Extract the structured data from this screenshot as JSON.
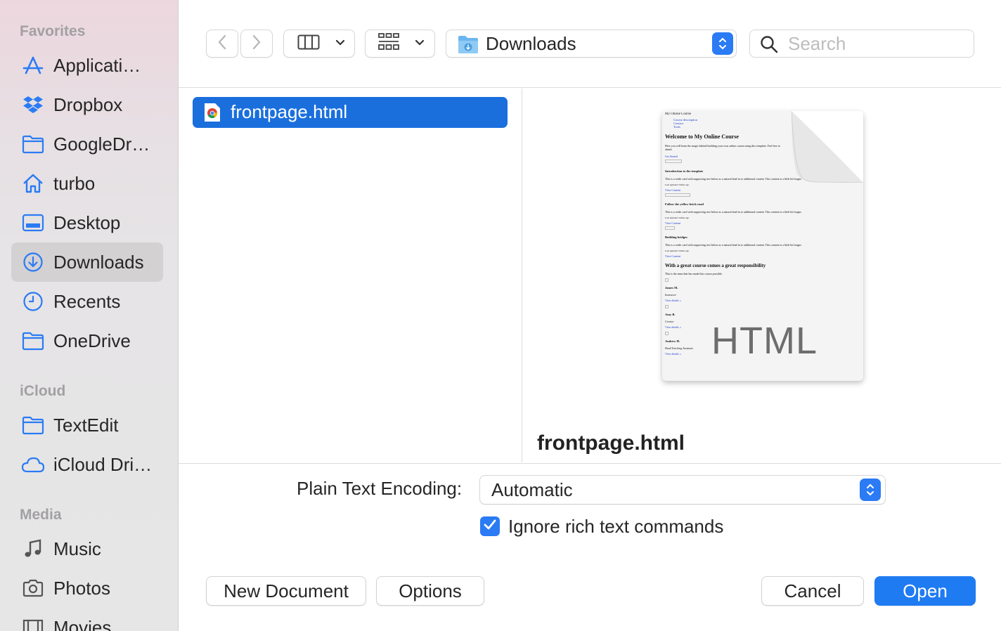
{
  "sidebar": {
    "sections": {
      "favorites": "Favorites",
      "icloud": "iCloud",
      "media": "Media"
    },
    "items": [
      {
        "label": "Applicati…",
        "icon": "applications-icon"
      },
      {
        "label": "Dropbox",
        "icon": "dropbox-icon"
      },
      {
        "label": "GoogleDr…",
        "icon": "folder-icon"
      },
      {
        "label": "turbo",
        "icon": "home-icon"
      },
      {
        "label": "Desktop",
        "icon": "desktop-icon"
      },
      {
        "label": "Downloads",
        "icon": "downloads-icon",
        "selected": true
      },
      {
        "label": "Recents",
        "icon": "clock-icon"
      },
      {
        "label": "OneDrive",
        "icon": "folder-icon"
      },
      {
        "label": "TextEdit",
        "icon": "folder-icon"
      },
      {
        "label": "iCloud Dri…",
        "icon": "cloud-icon"
      },
      {
        "label": "Music",
        "icon": "music-note-icon"
      },
      {
        "label": "Photos",
        "icon": "camera-icon"
      },
      {
        "label": "Movies",
        "icon": "film-icon"
      }
    ]
  },
  "toolbar": {
    "location": "Downloads",
    "search_placeholder": "Search"
  },
  "files": [
    {
      "name": "frontpage.html",
      "selected": true
    }
  ],
  "preview": {
    "title": "frontpage.html",
    "type_label": "HTML",
    "thumbnail": {
      "site_name": "My Online Course",
      "nav": [
        "Course description",
        "Contact",
        "Tools"
      ],
      "heading": "Welcome to My Online Course",
      "intro": "Here you will learn the magic behind building your own online course using this template. Feel free to",
      "intro2": "ahead.",
      "cta": "Get Started",
      "cards": [
        {
          "title": "Introduction to the template",
          "text": "This is a wider card with supporting text below as a natural lead-in to additional content. This content is a little bit longer.",
          "meta": "Last updated 3 mins ago",
          "link": "View Content"
        },
        {
          "title": "Follow the yellow brick road",
          "text": "This is a wider card with supporting text below as a natural lead-in to additional content. This content is a little bit longer.",
          "meta": "Last updated 3 mins ago",
          "link": "View Content"
        },
        {
          "title": "Building bridges",
          "text": "This is a wider card with supporting text below as a natural lead-in to additional content. This content is a little bit longer.",
          "meta": "Last updated 3 mins ago",
          "link": "View Content"
        }
      ],
      "team_heading": "With a great course comes a great responsibility",
      "team_intro": "This is the team that has made this course possible.",
      "team": [
        {
          "name": "James M.",
          "role": "Instructor",
          "link": "View details »"
        },
        {
          "name": "Amy B.",
          "role": "Creator",
          "link": "View details »"
        },
        {
          "name": "Andrew H.",
          "role": "Head Teaching Assistant",
          "link": "View details »"
        }
      ]
    }
  },
  "options": {
    "encoding_label": "Plain Text Encoding:",
    "encoding_value": "Automatic",
    "ignore_rich_text_label": "Ignore rich text commands",
    "ignore_rich_text_checked": true
  },
  "buttons": {
    "new_document": "New Document",
    "options": "Options",
    "cancel": "Cancel",
    "open": "Open"
  },
  "colors": {
    "accent": "#1f7bf2",
    "selection": "#1a6fdd",
    "sidebar_icon": "#2a7bf4"
  }
}
